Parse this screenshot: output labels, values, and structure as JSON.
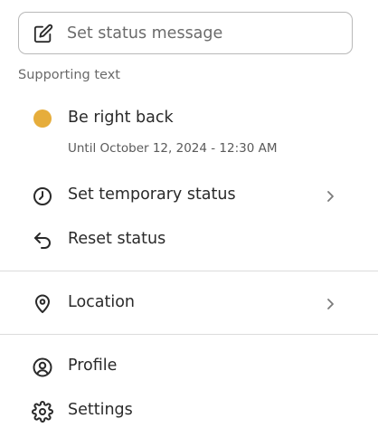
{
  "status_input": {
    "placeholder": "Set status message",
    "icon": "edit-icon"
  },
  "supporting_text": "Supporting text",
  "current_status": {
    "label": "Be right back",
    "until": "Until October 12, 2024 - 12:30 AM",
    "color": "#e6ad3b"
  },
  "menu": {
    "temporary_status": {
      "label": "Set temporary status",
      "icon": "clock-icon"
    },
    "reset_status": {
      "label": "Reset status",
      "icon": "undo-icon"
    },
    "location": {
      "label": "Location",
      "icon": "location-pin-icon"
    },
    "profile": {
      "label": "Profile",
      "icon": "user-circle-icon"
    },
    "settings": {
      "label": "Settings",
      "icon": "gear-icon"
    }
  }
}
